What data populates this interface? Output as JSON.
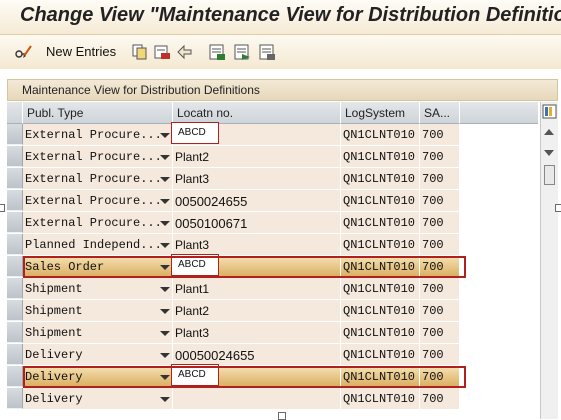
{
  "window": {
    "title": "Change View \"Maintenance View for Distribution Definition:"
  },
  "toolbar": {
    "new_entries_label": "New Entries",
    "icons": [
      "glasses-pencil-icon",
      "copy-icon",
      "delete-icon",
      "undo-icon",
      "select-all-icon",
      "select-block-icon",
      "deselect-all-icon"
    ]
  },
  "panel": {
    "title": "Maintenance View for Distribution Definitions"
  },
  "table": {
    "columns": [
      "Publ. Type",
      "Locatn no.",
      "LogSystem",
      "SA..."
    ],
    "rows": [
      {
        "publ_type": "External Procure...",
        "location": "ABCD",
        "log_system": "QN1CLNT010",
        "sa": "700"
      },
      {
        "publ_type": "External Procure...",
        "location": "Plant2",
        "log_system": "QN1CLNT010",
        "sa": "700"
      },
      {
        "publ_type": "External Procure...",
        "location": "Plant3",
        "log_system": "QN1CLNT010",
        "sa": "700"
      },
      {
        "publ_type": "External Procure...",
        "location": "0050024655",
        "log_system": "QN1CLNT010",
        "sa": "700"
      },
      {
        "publ_type": "External Procure...",
        "location": "0050100671",
        "log_system": "QN1CLNT010",
        "sa": "700"
      },
      {
        "publ_type": "Planned Independ...",
        "location": "Plant3",
        "log_system": "QN1CLNT010",
        "sa": "700"
      },
      {
        "publ_type": "Sales Order",
        "location": "ABCD",
        "log_system": "QN1CLNT010",
        "sa": "700"
      },
      {
        "publ_type": "Shipment",
        "location": "Plant1",
        "log_system": "QN1CLNT010",
        "sa": "700"
      },
      {
        "publ_type": "Shipment",
        "location": "Plant2",
        "log_system": "QN1CLNT010",
        "sa": "700"
      },
      {
        "publ_type": "Shipment",
        "location": "Plant3",
        "log_system": "QN1CLNT010",
        "sa": "700"
      },
      {
        "publ_type": "Delivery",
        "location": "00050024655",
        "log_system": "QN1CLNT010",
        "sa": "700"
      },
      {
        "publ_type": "Delivery",
        "location": "ABCD",
        "log_system": "QN1CLNT010",
        "sa": "700"
      },
      {
        "publ_type": "Delivery",
        "location": "",
        "log_system": "QN1CLNT010",
        "sa": "700"
      }
    ]
  },
  "highlighted_rows": [
    6,
    11
  ],
  "colors": {
    "highlight_border": "#b0201c",
    "selected_row": "#d9ad60",
    "cell_bg": "#f5e8dc"
  }
}
